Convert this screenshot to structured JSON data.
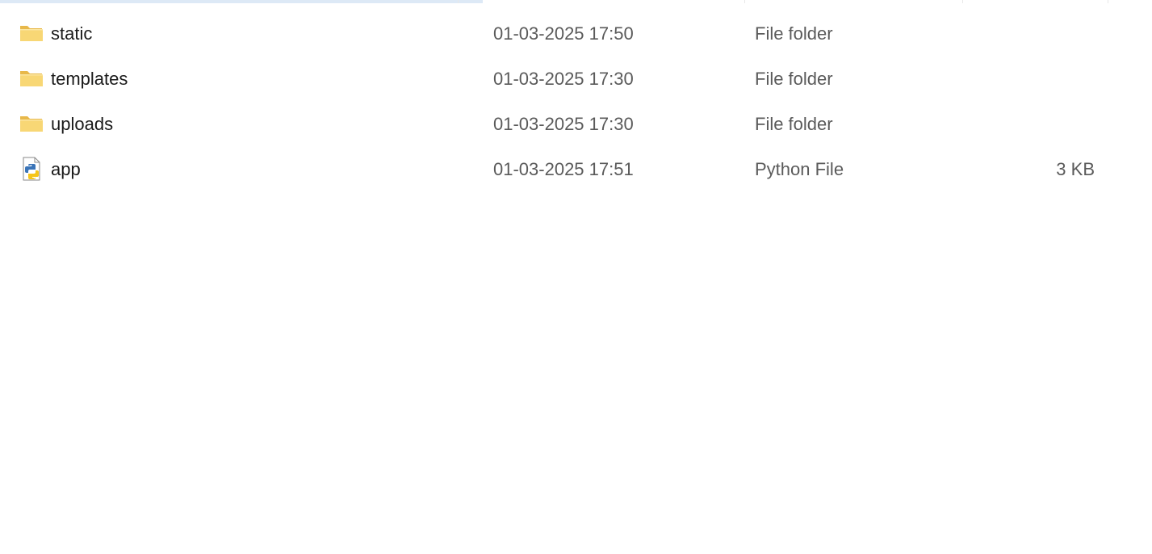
{
  "files": [
    {
      "name": "static",
      "modified": "01-03-2025 17:50",
      "type": "File folder",
      "size": "",
      "icon": "folder-icon"
    },
    {
      "name": "templates",
      "modified": "01-03-2025 17:30",
      "type": "File folder",
      "size": "",
      "icon": "folder-icon"
    },
    {
      "name": "uploads",
      "modified": "01-03-2025 17:30",
      "type": "File folder",
      "size": "",
      "icon": "folder-icon"
    },
    {
      "name": "app",
      "modified": "01-03-2025 17:51",
      "type": "Python File",
      "size": "3 KB",
      "icon": "python-file-icon"
    }
  ],
  "colors": {
    "folder_fill": "#f8d775",
    "folder_tab": "#e8b84a",
    "python_blue": "#3a74b8",
    "python_yellow": "#f5c518",
    "header_strip": "#dde9f6"
  }
}
